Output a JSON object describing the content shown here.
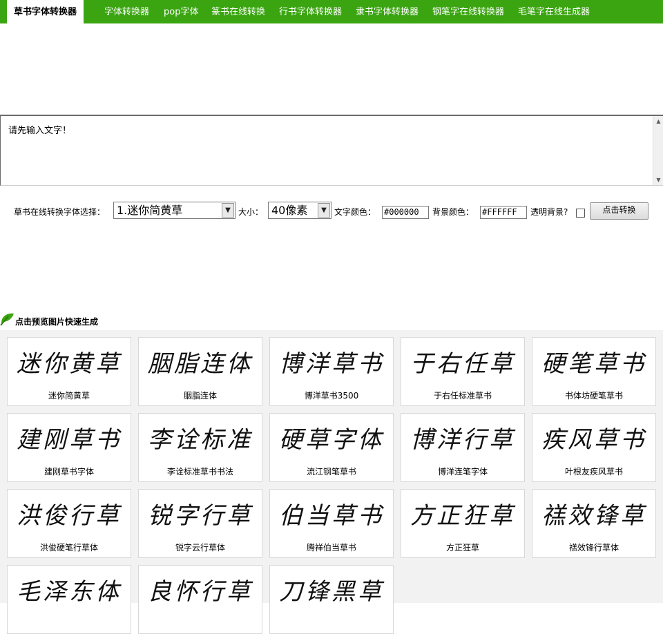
{
  "nav": {
    "active": "草书字体转换器",
    "items": [
      "字体转换器",
      "pop字体",
      "篆书在线转换",
      "行书字体转换器",
      "隶书字体转换器",
      "钢笔字在线转换器",
      "毛笔字在线生成器"
    ]
  },
  "textarea": {
    "value": "请先输入文字！"
  },
  "controls": {
    "font_label": "草书在线转换字体选择：",
    "font_selected": "1.迷你简黄草",
    "size_label": "大小：",
    "size_selected": "40像素",
    "text_color_label": "文字颜色：",
    "text_color_value": "#000000",
    "bg_color_label": "背景颜色：",
    "bg_color_value": "#FFFFFF",
    "transparent_label": "透明背景?",
    "convert_button": "点击转换"
  },
  "preview_heading": "点击预览图片快速生成",
  "fonts": [
    {
      "preview": "迷你黄草",
      "name": "迷你简黄草"
    },
    {
      "preview": "胭脂连体",
      "name": "胭脂连体"
    },
    {
      "preview": "博洋草书",
      "name": "博洋草书3500"
    },
    {
      "preview": "于右任草",
      "name": "于右任标准草书"
    },
    {
      "preview": "硬笔草书",
      "name": "书体坊硬笔草书"
    },
    {
      "preview": "建刚草书",
      "name": "建刚草书字体"
    },
    {
      "preview": "李诠标准",
      "name": "李诠标准草书书法"
    },
    {
      "preview": "硬草字体",
      "name": "流江钢笔草书"
    },
    {
      "preview": "博洋行草",
      "name": "博洋连笔字体"
    },
    {
      "preview": "疾风草书",
      "name": "叶根友疾风草书"
    },
    {
      "preview": "洪俊行草",
      "name": "洪俊硬笔行草体"
    },
    {
      "preview": "锐字行草",
      "name": "锐字云行草体"
    },
    {
      "preview": "伯当草书",
      "name": "腾祥伯当草书"
    },
    {
      "preview": "方正狂草",
      "name": "方正狂草"
    },
    {
      "preview": "禚效锋草",
      "name": "禚效锋行草体"
    },
    {
      "preview": "毛泽东体",
      "name": ""
    },
    {
      "preview": "良怀行草",
      "name": ""
    },
    {
      "preview": "刀锋黑草",
      "name": ""
    }
  ],
  "colors": {
    "nav_green": "#3aa510",
    "gallery_bg": "#f2f2f2"
  }
}
